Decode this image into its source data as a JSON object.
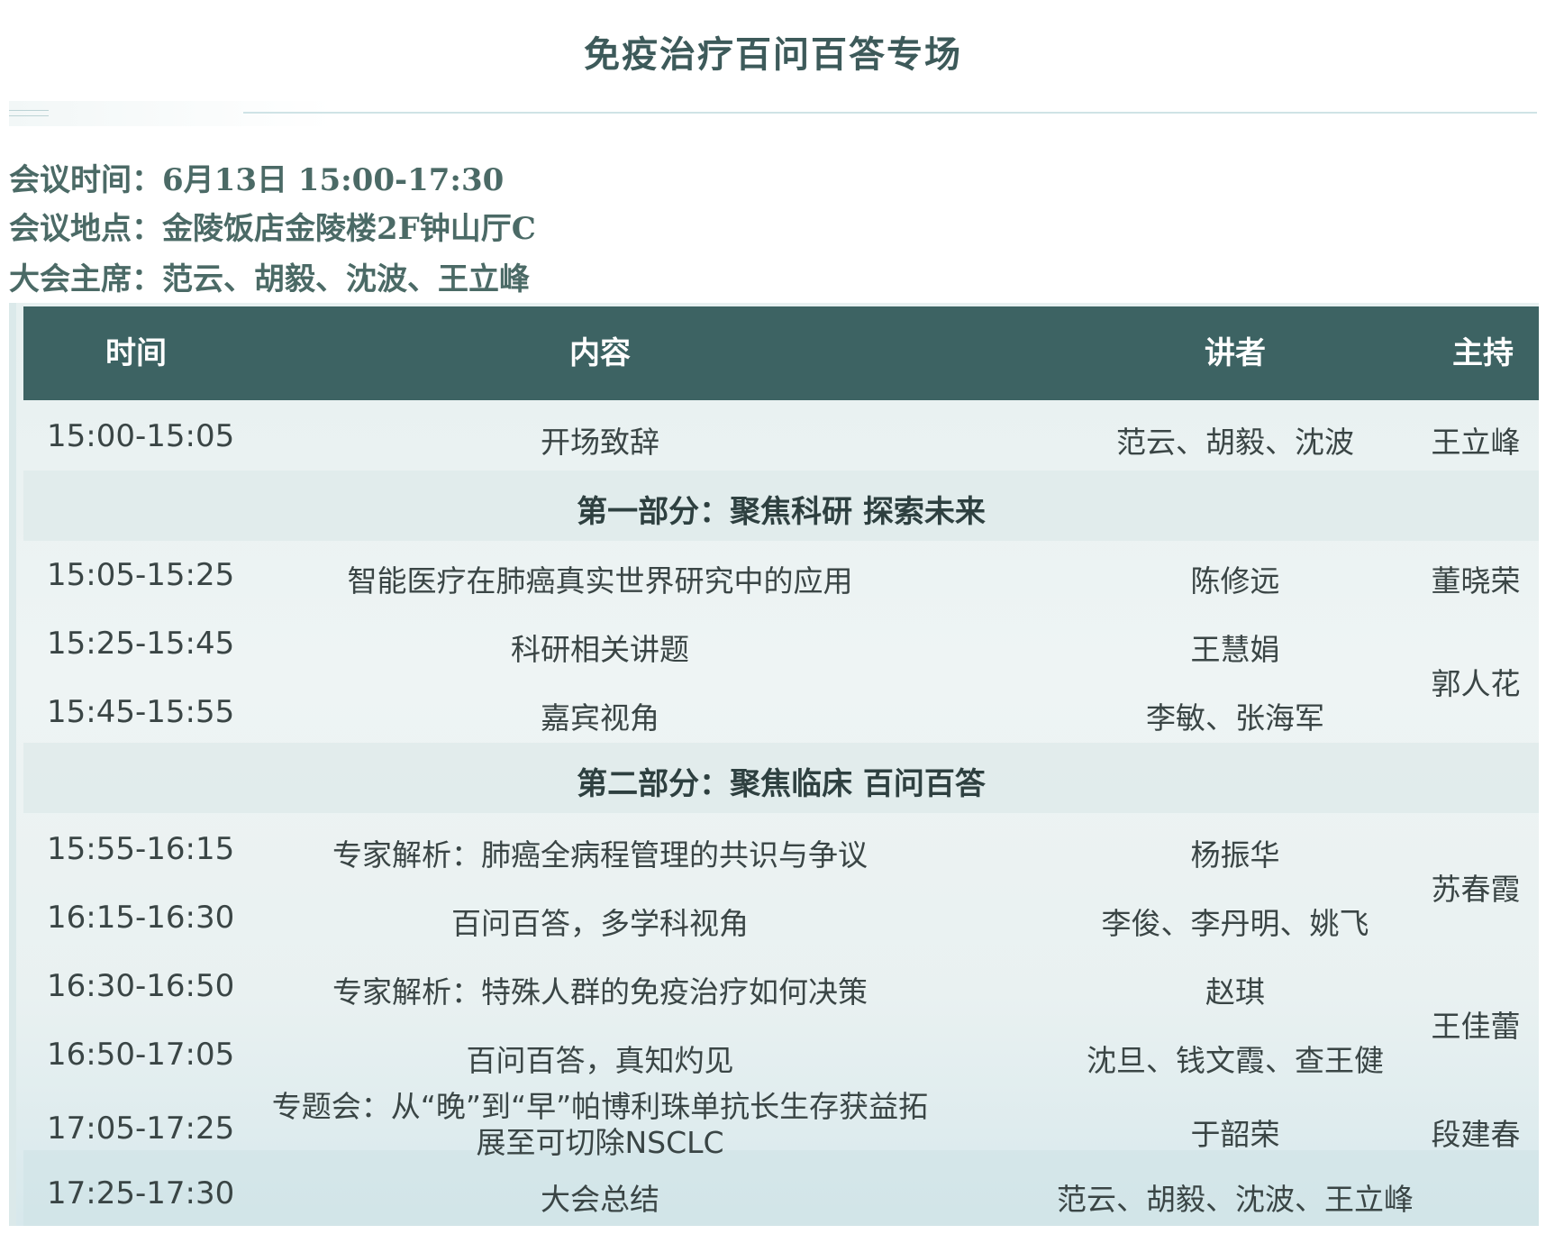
{
  "title": "免疫治疗百问百答专场",
  "meta": {
    "time_label": "会议时间：",
    "time_value": "6月13日 15:00-17:30",
    "place_label": "会议地点：",
    "place_value": "金陵饭店金陵楼2F钟山厅C",
    "chair_label": "大会主席：",
    "chair_value": "范云、胡毅、沈波、王立峰"
  },
  "table": {
    "headers": [
      "时间",
      "内容",
      "讲者",
      "主持"
    ],
    "rows": [
      {
        "time": "15:00-15:05",
        "content": "开场致辞",
        "speaker": "范云、胡毅、沈波"
      },
      {
        "time": "15:05-15:25",
        "content": "智能医疗在肺癌真实世界研究中的应用",
        "speaker": "陈修远"
      },
      {
        "time": "15:25-15:45",
        "content": "科研相关讲题",
        "speaker": "王慧娟"
      },
      {
        "time": "15:45-15:55",
        "content": "嘉宾视角",
        "speaker": "李敏、张海军"
      },
      {
        "time": "15:55-16:15",
        "content": "专家解析：肺癌全病程管理的共识与争议",
        "speaker": "杨振华"
      },
      {
        "time": "16:15-16:30",
        "content": "百问百答，多学科视角",
        "speaker": "李俊、李丹明、姚飞"
      },
      {
        "time": "16:30-16:50",
        "content": "专家解析：特殊人群的免疫治疗如何决策",
        "speaker": "赵琪"
      },
      {
        "time": "16:50-17:05",
        "content": "百问百答，真知灼见",
        "speaker": "沈旦、钱文霞、查王健"
      },
      {
        "time": "17:05-17:25",
        "content_line1": "专题会：从“晚”到“早”帕博利珠单抗长生存获益拓",
        "content_line2": "展至可切除NSCLC",
        "speaker": "于韶荣"
      },
      {
        "time": "17:25-17:30",
        "content": "大会总结",
        "speaker": "范云、胡毅、沈波、王立峰"
      }
    ],
    "sections": [
      "第一部分：聚焦科研 探索未来",
      "第二部分：聚焦临床 百问百答"
    ],
    "hosts": [
      "王立峰",
      "董晓荣",
      "郭人花",
      "苏春霞",
      "王佳蕾",
      "段建春"
    ]
  }
}
